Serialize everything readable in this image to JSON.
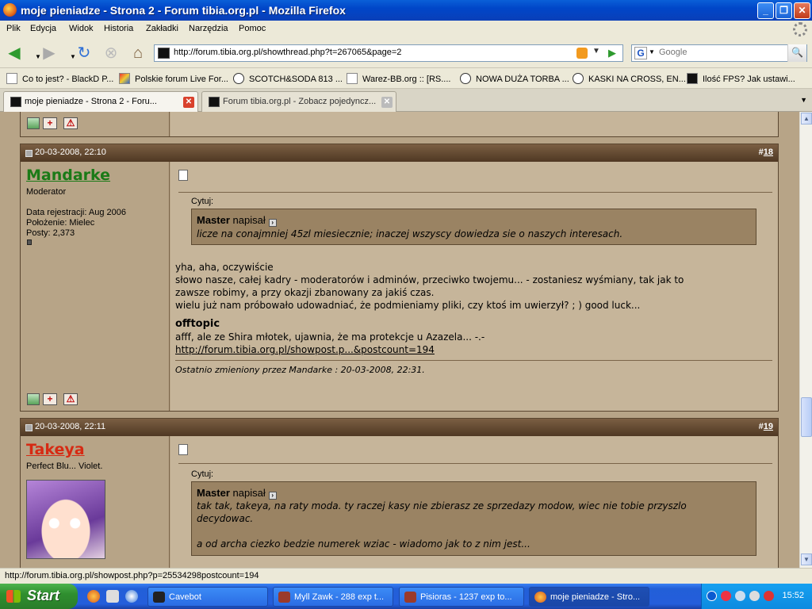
{
  "window": {
    "title": "moje pieniadze - Strona 2 - Forum tibia.org.pl - Mozilla Firefox",
    "minimize_glyph": "_",
    "maximize_glyph": "❐",
    "close_glyph": "✕"
  },
  "menu": [
    "Plik",
    "Edycja",
    "Widok",
    "Historia",
    "Zakładki",
    "Narzędzia",
    "Pomoc"
  ],
  "nav": {
    "url": "http://forum.tibia.org.pl/showthread.php?t=267065&page=2",
    "search_placeholder": "Google",
    "search_engine_glyph": "G",
    "icons": [
      "back-icon",
      "forward-icon",
      "reload-icon",
      "stop-icon",
      "home-icon"
    ]
  },
  "bookmarks": [
    "Co to jest? - BlackD P...",
    "Polskie forum Live For...",
    "SCOTCH&SODA 813 ...",
    "Warez-BB.org :: [RS....",
    "NOWA DUŻA TORBA ...",
    "KASKI NA CROSS, EN...",
    "Ilość FPS? Jak ustawi..."
  ],
  "tabs": [
    {
      "label": "moje pieniadze - Strona 2 - Foru...",
      "active": true
    },
    {
      "label": "Forum tibia.org.pl - Zobacz pojedyncz...",
      "active": false
    }
  ],
  "posts": [
    {
      "date": "20-03-2008, 22:10",
      "number_prefix": "#",
      "number": "18",
      "username": "Mandarke",
      "user_title": "Moderator",
      "info": [
        "Data rejestracji: Aug 2006",
        "Położenie: Mielec",
        "Posty: 2,373"
      ],
      "quote_label": "Cytuj:",
      "quote_author": "Master",
      "quote_said": "napisał",
      "quote_lines": [
        "licze na conajmniej 45zl miesiecznie; inaczej wszyscy dowiedza sie o naszych interesach."
      ],
      "message_lines": [
        "yha, aha, oczywiście",
        "słowo nasze, całej kadry - moderatorów i adminów, przeciwko twojemu... - zostaniesz wyśmiany, tak jak to",
        "zawsze robimy, a przy okazji zbanowany za jakiś czas.",
        "wielu już nam próbowało udowadniać, że podmieniamy pliki, czy ktoś im uwierzył? ; ) good luck..."
      ],
      "offtopic_title": "offtopic",
      "offtopic_line": "afff, ale ze Shira młotek, ujawnia, że ma protekcje u Azazela... -.-",
      "offtopic_link": "http://forum.tibia.org.pl/showpost.p...&postcount=194",
      "edited": "Ostatnio zmieniony przez Mandarke : 20-03-2008, 22:31."
    },
    {
      "date": "20-03-2008, 22:11",
      "number_prefix": "#",
      "number": "19",
      "username": "Takeya",
      "user_title": "Perfect Blu... Violet.",
      "quote_label": "Cytuj:",
      "quote_author": "Master",
      "quote_said": "napisał",
      "quote_lines": [
        "tak tak, takeya, na raty moda. ty raczej kasy nie zbierasz ze sprzedazy modow, wiec nie tobie przyszlo",
        "decydowac.",
        "",
        "a od archa ciezko bedzie numerek wziac - wiadomo jak to z nim jest..."
      ]
    }
  ],
  "post_actions": {
    "plus_glyph": "+",
    "warn_glyph": "⚠"
  },
  "status": "http://forum.tibia.org.pl/showpost.php?p=25534298postcount=194",
  "taskbar": {
    "start": "Start",
    "tasks": [
      "Cavebot",
      "Myll Zawk - 288 exp t...",
      "Pisioras - 1237 exp to...",
      "moje pieniadze - Stro..."
    ],
    "clock": "15:52"
  }
}
